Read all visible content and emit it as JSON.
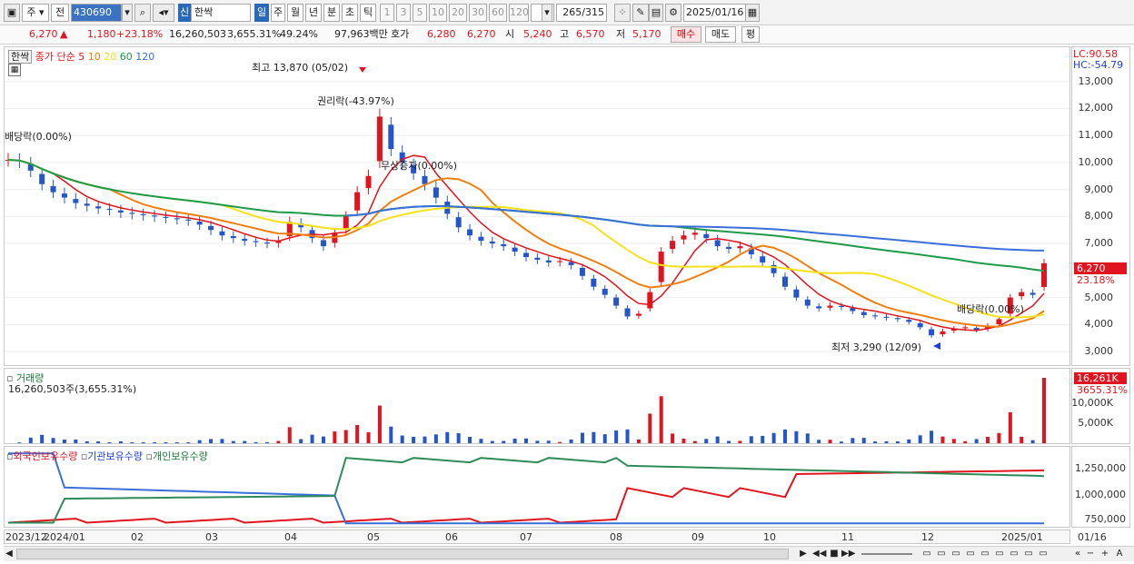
{
  "toolbar": {
    "period_label": "주",
    "prev_label": "전",
    "code": "430690",
    "market_badge": "신",
    "stock_name": "한싹",
    "intervals": [
      "일",
      "주",
      "월",
      "년",
      "분",
      "초",
      "틱"
    ],
    "counts": [
      "1",
      "3",
      "5",
      "10",
      "20",
      "30",
      "60",
      "120"
    ],
    "page_position": "265",
    "page_total": "/315",
    "date": "2025/01/16"
  },
  "quote": {
    "price": "6,270",
    "direction": "▲",
    "change": "1,180",
    "change_pct": "+23.18%",
    "volume": "16,260,503",
    "volume_ratio": "3,655.31%",
    "turnover": "49.24%",
    "amount": "97,963백만",
    "bid_label": "호가",
    "bid": "6,280",
    "ask": "6,270",
    "open_label": "시",
    "open": "5,240",
    "high_label": "고",
    "high": "6,570",
    "low_label": "저",
    "low": "5,170",
    "buy_button": "매수",
    "sell_button": "매도",
    "extra_button": "평"
  },
  "price_panel": {
    "name_tag": "한싹",
    "ma_label": "종가 단순",
    "ma_periods": [
      {
        "label": "5",
        "color": "#e0141e"
      },
      {
        "label": "10",
        "color": "#f07f10"
      },
      {
        "label": "20",
        "color": "#f5e21a"
      },
      {
        "label": "60",
        "color": "#1e9a4a"
      },
      {
        "label": "120",
        "color": "#3a6fd8"
      }
    ],
    "lc": "LC:90.58",
    "hc": "HC:-54.79",
    "annotations": {
      "high": "최고 13,870 (05/02)",
      "rights": "권리락(-43.97%)",
      "dividend1": "배당락(0.00%)",
      "bonus": "무상증자(0.00%)",
      "dividend2": "배당락(0.00%)",
      "low": "최저 3,290 (12/09)"
    },
    "price_tag": "6,270",
    "pct_tag": "23.18%",
    "y_ticks": [
      "13,000",
      "12,000",
      "11,000",
      "10,000",
      "9,000",
      "8,000",
      "7,000",
      "5,000",
      "4,000",
      "3,000"
    ]
  },
  "volume_panel": {
    "title": "거래량",
    "info": "16,260,503주(3,655.31%)",
    "tag_value": "16,261K",
    "tag_pct": "3655.31%",
    "y_ticks": [
      "10,000K",
      "5,000K"
    ]
  },
  "holdings_panel": {
    "legend": [
      {
        "label": "외국인보유수량",
        "color": "#e0141e"
      },
      {
        "label": "기관보유수량",
        "color": "#3a6fd8"
      },
      {
        "label": "개인보유수량",
        "color": "#2e8b57"
      }
    ],
    "y_ticks": [
      "1,250,000",
      "1,000,000",
      "750,000"
    ]
  },
  "x_axis": [
    "2023/12",
    "2024/01",
    "02",
    "03",
    "04",
    "05",
    "06",
    "07",
    "08",
    "09",
    "10",
    "11",
    "12",
    "2025/01"
  ],
  "x_axis_right": "01/16",
  "chart_data": {
    "type": "candlestick",
    "price_range": [
      2700,
      14000
    ],
    "key_points": [
      {
        "label": "최고",
        "value": 13870,
        "date": "05/02"
      },
      {
        "label": "최저",
        "value": 3290,
        "date": "12/09"
      }
    ],
    "close_series": [
      10100,
      10050,
      9700,
      9200,
      8900,
      8700,
      8500,
      8400,
      8300,
      8250,
      8150,
      8100,
      8050,
      8000,
      7950,
      7900,
      7850,
      7700,
      7500,
      7300,
      7200,
      7100,
      7050,
      7000,
      7100,
      7800,
      7600,
      7200,
      6900,
      7400,
      8000,
      8900,
      9500,
      11700,
      10500,
      10000,
      9600,
      9200,
      8700,
      8100,
      7600,
      7300,
      7100,
      7000,
      6900,
      6700,
      6500,
      6400,
      6300,
      6350,
      6200,
      5800,
      5400,
      5100,
      4700,
      4300,
      4400,
      5200,
      6700,
      7100,
      7300,
      7400,
      7200,
      6900,
      6800,
      6900,
      6600,
      6300,
      5900,
      5400,
      5000,
      4700,
      4600,
      4700,
      4650,
      4500,
      4350,
      4300,
      4250,
      4200,
      4100,
      3900,
      3600,
      3750,
      3850,
      3900,
      3800,
      3950,
      4200,
      5000,
      5200,
      5100,
      6270
    ],
    "volume_max_K": 16261,
    "volume_units": "K"
  }
}
